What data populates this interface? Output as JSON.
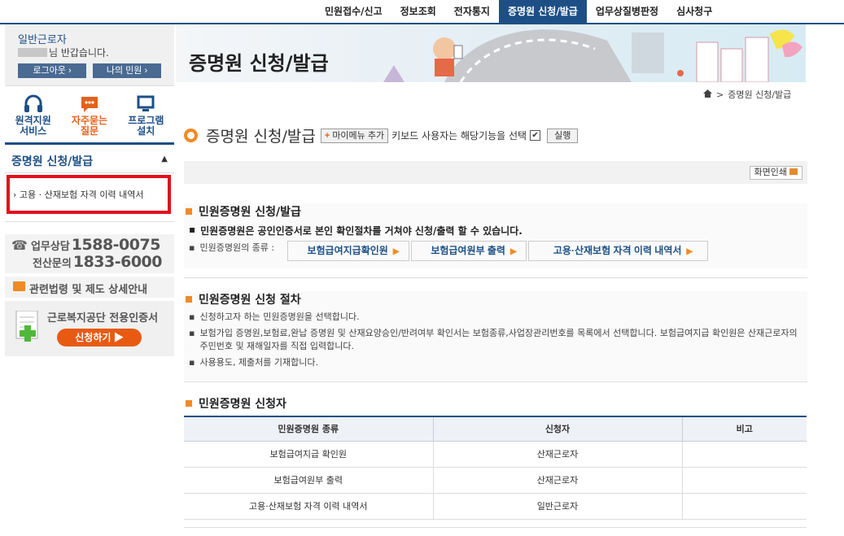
{
  "topnav": {
    "items": [
      "민원접수/신고",
      "정보조회",
      "전자통지",
      "증명원 신청/발급",
      "업무상질병판정",
      "심사청구"
    ],
    "active_index": 3
  },
  "sidebar": {
    "user_type": "일반근로자",
    "greeting_suffix": "님 반갑습니다.",
    "logout_label": "로그아웃",
    "my_petition_label": "나의 민원",
    "quick": [
      {
        "label_line1": "원격지원",
        "label_line2": "서비스",
        "icon": "headset-icon"
      },
      {
        "label_line1": "자주묻는",
        "label_line2": "질문",
        "icon": "chat-bubble-icon"
      },
      {
        "label_line1": "프로그램",
        "label_line2": "설치",
        "icon": "monitor-icon"
      }
    ],
    "section_title": "증명원 신청/발급",
    "sub_item": "고용 · 산재보험 자격 이력 내역서",
    "phone": {
      "label1": "업무상담",
      "number1": "1588-0075",
      "label2": "전산문의",
      "number2": "1833-6000"
    },
    "law_link": "관련법령 및 제도 상세안내",
    "cert_title": "근로복지공단 전용인증서",
    "cert_button": "신청하기"
  },
  "banner": {
    "title": "증명원 신청/발급"
  },
  "breadcrumb": {
    "current": "증명원 신청/발급"
  },
  "page_head": {
    "title": "증명원 신청/발급",
    "mymenu_label": "마이메뉴 추가",
    "keyboard_text": "키보드 사용자는 해당기능을 선택",
    "run_label": "실행"
  },
  "print_label": "화면인쇄",
  "section1": {
    "title": "민원증명원 신청/발급",
    "notice": "민원증명원은 공인인증서로 본인 확인절차를 거쳐야 신청/출력 할 수 있습니다.",
    "types_label": "민원증명원의 종류 :",
    "types": [
      "보험급여지급확인원",
      "보험급여원부 출력",
      "고용·산재보험 자격 이력 내역서"
    ]
  },
  "section2": {
    "title": "민원증명원 신청 절차",
    "steps": [
      "신청하고자 하는 민원증명원을 선택합니다.",
      "보험가입 증명원,보험료,완납 증명원 및 산재요양승인/반려여부 확인서는 보험종류,사업장관리번호를 목록에서 선택합니다. 보험급여지급 확인원은 산재근로자의 주민번호 및 재해일자를 직접 입력합니다.",
      "사용용도, 제출처를 기재합니다."
    ]
  },
  "section3": {
    "title": "민원증명원 신청자",
    "headers": [
      "민원증명원 종류",
      "신청자",
      "비고"
    ],
    "rows": [
      [
        "보험급여지급 확인원",
        "산재근로자",
        ""
      ],
      [
        "보험급여원부 출력",
        "산재근로자",
        ""
      ],
      [
        "고용·산재보험 자격 이력 내역서",
        "일반근로자",
        ""
      ]
    ]
  },
  "colors": {
    "primary": "#1d4f86",
    "accent": "#f28a23",
    "highlight": "#e30f1c"
  }
}
